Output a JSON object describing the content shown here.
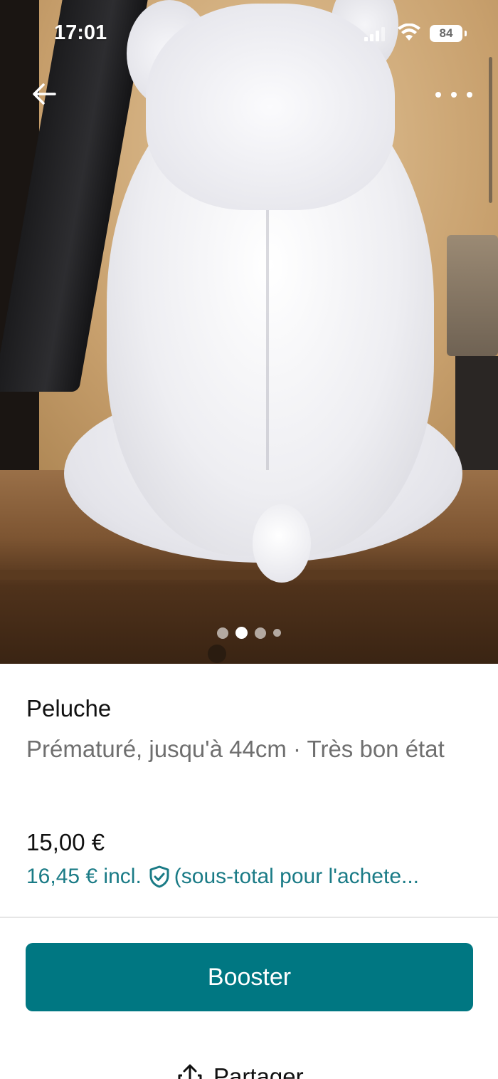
{
  "status_bar": {
    "time": "17:01",
    "battery": "84"
  },
  "nav": {
    "back_icon": "arrow-left-icon",
    "more_icon": "more-horizontal-icon"
  },
  "gallery": {
    "image_count": 4,
    "active_index": 1
  },
  "item": {
    "title": "Peluche",
    "subtitle": "Prématuré, jusqu'à 44cm · Très bon état",
    "price": "15,00 €",
    "buyer_price": "16,45 € incl.",
    "buyer_price_suffix": "(sous-total pour l'achete..."
  },
  "actions": {
    "booster_label": "Booster",
    "share_label": "Partager"
  },
  "colors": {
    "accent": "#007782",
    "link": "#1a7b86"
  }
}
